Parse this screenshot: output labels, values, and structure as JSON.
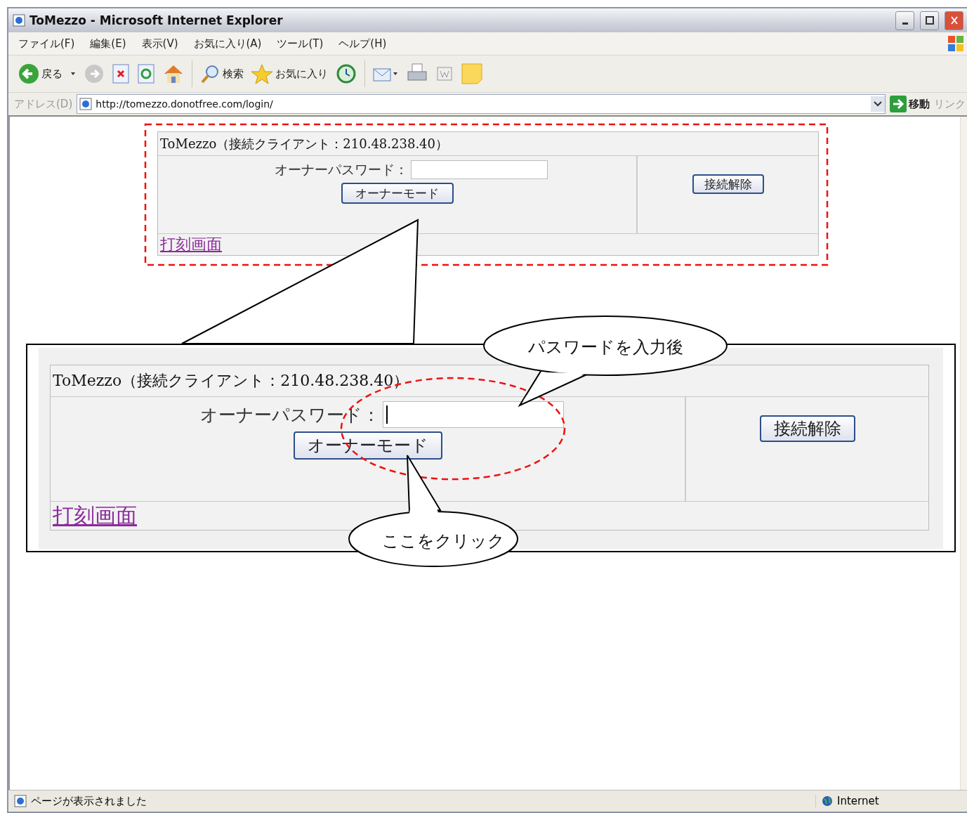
{
  "window": {
    "title": "ToMezzo - Microsoft Internet Explorer"
  },
  "menu": [
    "ファイル(F)",
    "編集(E)",
    "表示(V)",
    "お気に入り(A)",
    "ツール(T)",
    "ヘルプ(H)"
  ],
  "toolbar": {
    "back": "戻る",
    "search": "検索",
    "favorites": "お気に入り"
  },
  "address": {
    "label": "アドレス(D)",
    "url": "http://tomezzo.donotfree.com/login/",
    "go": "移動",
    "links": "リンク"
  },
  "form": {
    "title": "ToMezzo（接続クライアント：210.48.238.40）",
    "password_label": "オーナーパスワード：",
    "owner_button": "オーナーモード",
    "disconnect_button": "接続解除",
    "link": "打刻画面"
  },
  "zoomed_form": {
    "title": "ToMezzo（接続クライアント：210.48.238.40）",
    "password_label": "オーナーパスワード：",
    "owner_button": "オーナーモード",
    "disconnect_button": "接続解除",
    "link": "打刻画面",
    "caret": true
  },
  "callouts": [
    {
      "kind": "input",
      "text": "パスワードを入力後"
    },
    {
      "kind": "click",
      "text": "ここをクリック"
    }
  ],
  "status_bar": {
    "text": "ページが表示されました",
    "zone": "Internet"
  }
}
